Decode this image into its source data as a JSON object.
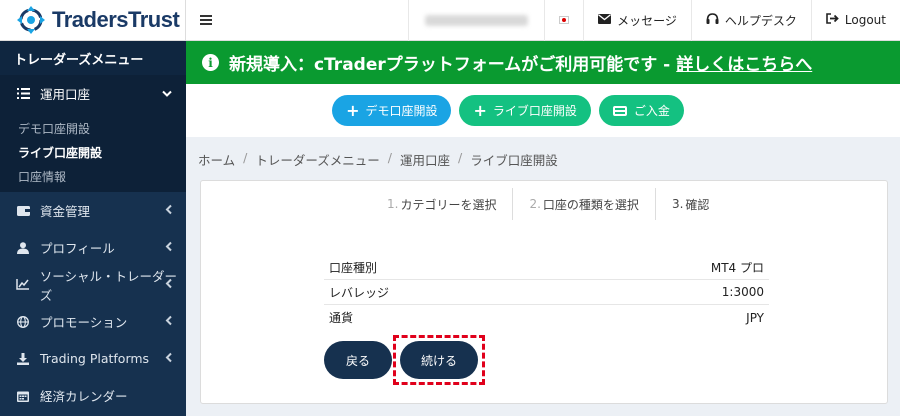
{
  "brand": {
    "name": "TradersTrust"
  },
  "sidebar": {
    "menu_title": "トレーダーズメニュー",
    "active_section": {
      "label": "運用口座",
      "icon": "list-icon"
    },
    "sub_items": [
      {
        "label": "デモ口座開設",
        "current": false
      },
      {
        "label": "ライブ口座開設",
        "current": true
      },
      {
        "label": "口座情報",
        "current": false
      }
    ],
    "items": [
      {
        "label": "資金管理",
        "icon": "wallet-icon"
      },
      {
        "label": "プロフィール",
        "icon": "user-icon"
      },
      {
        "label": "ソーシャル・トレーダーズ",
        "icon": "chart-icon"
      },
      {
        "label": "プロモーション",
        "icon": "globe-icon"
      },
      {
        "label": "Trading Platforms",
        "icon": "download-icon"
      },
      {
        "label": "経済カレンダー",
        "icon": "calendar-icon"
      }
    ]
  },
  "topbar": {
    "menu_icon": "hamburger-icon",
    "messages_label": "メッセージ",
    "help_label": "ヘルプデスク",
    "logout_label": "Logout"
  },
  "banner": {
    "text": "新規導入：cTraderプラットフォームがご利用可能です - ",
    "link": "詳しくはこちらへ",
    "color": "#0a9a30"
  },
  "actions": {
    "demo_label": "デモ口座開設",
    "live_label": "ライブ口座開設",
    "deposit_label": "ご入金"
  },
  "breadcrumb": [
    "ホーム",
    "トレーダーズメニュー",
    "運用口座",
    "ライブ口座開設"
  ],
  "steps": [
    {
      "num": "1.",
      "label": "カテゴリーを選択"
    },
    {
      "num": "2.",
      "label": "口座の種類を選択"
    },
    {
      "num": "3.",
      "label": "確認"
    }
  ],
  "summary": [
    {
      "label": "口座種別",
      "value": "MT4 プロ"
    },
    {
      "label": "レバレッジ",
      "value": "1:3000"
    },
    {
      "label": "通貨",
      "value": "JPY"
    }
  ],
  "buttons": {
    "back_label": "戻る",
    "continue_label": "続ける"
  }
}
